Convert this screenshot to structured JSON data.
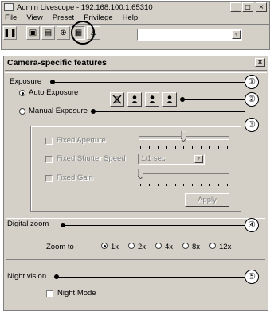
{
  "window": {
    "title": "Admin Livescope - 192.168.100.1:65310",
    "controls": [
      "_",
      "□",
      "×"
    ],
    "menu": [
      "File",
      "View",
      "Preset",
      "Privilege",
      "Help"
    ],
    "toolbar_icons": [
      "pause-icon",
      "pan-tilt-icon",
      "split-view-icon",
      "zoom-icon",
      "camera-settings-icon",
      "user-icon"
    ],
    "combo_value": ""
  },
  "panel": {
    "title": "Camera-specific features",
    "close_label": "×",
    "exposure": {
      "section_label": "Exposure",
      "auto_label": "Auto Exposure",
      "manual_label": "Manual Exposure",
      "selected": "auto",
      "auto_icons": [
        "fluorescent-off-icon",
        "person-icon",
        "person-icon",
        "person-icon"
      ],
      "fixed_aperture_label": "Fixed Aperture",
      "fixed_shutter_label": "Fixed Shutter Speed",
      "shutter_value": "1/1 sec",
      "fixed_gain_label": "Fixed Gain",
      "apply_label": "Apply",
      "aperture_level": 0.55,
      "gain_level": 0.02
    },
    "digital_zoom": {
      "section_label": "Digital zoom",
      "zoom_to_label": "Zoom to",
      "options": [
        "1x",
        "2x",
        "4x",
        "8x",
        "12x"
      ],
      "selected": "1x"
    },
    "night_vision": {
      "section_label": "Night vision",
      "night_mode_label": "Night Mode",
      "checked": false
    }
  },
  "callouts": [
    "①",
    "②",
    "③",
    "④",
    "⑤"
  ]
}
